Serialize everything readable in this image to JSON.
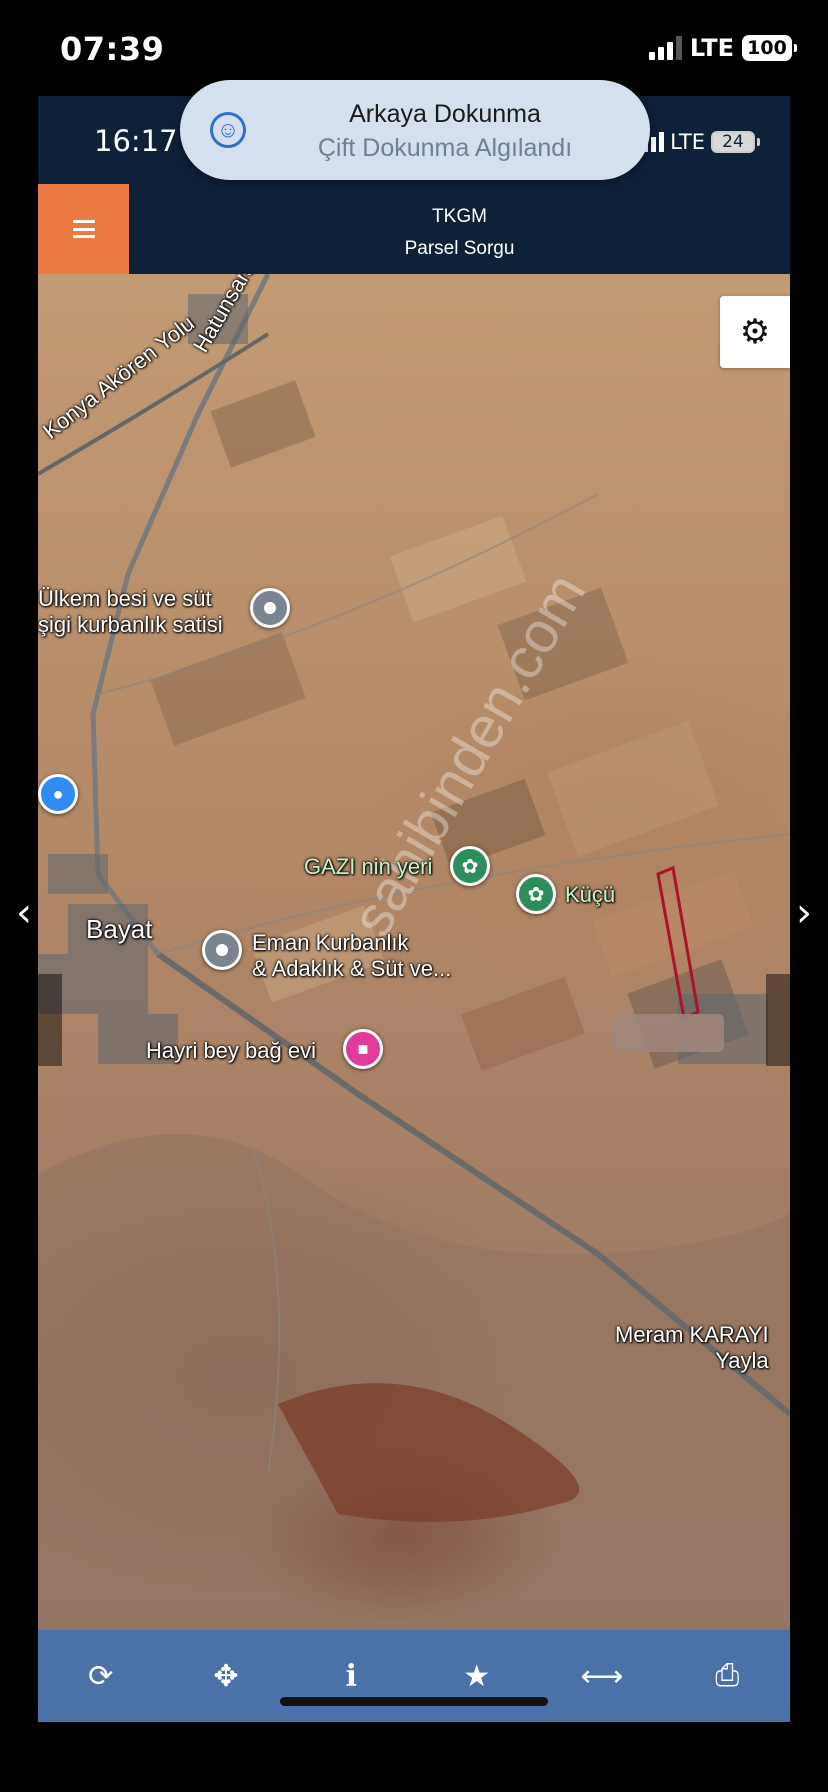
{
  "outer_status": {
    "time": "07:39",
    "network": "LTE",
    "battery": "100"
  },
  "inner_status": {
    "time": "16:17",
    "network": "LTE",
    "battery": "24"
  },
  "notification": {
    "title": "Arkaya Dokunma",
    "subtitle": "Çift Dokunma Algılandı",
    "icon": "accessibility-icon"
  },
  "header": {
    "title": "TKGM",
    "subtitle": "Parsel Sorgu",
    "menu_icon": "hamburger-icon",
    "accent_color": "#ec7a43",
    "background_color": "#0f2039"
  },
  "map": {
    "settings_icon": "gear-icon",
    "roads": [
      {
        "label": "Konya Akören Yolu"
      },
      {
        "label": "Hatunsaray"
      }
    ],
    "places": [
      {
        "label": "Ülkem besi ve süt\nşigi kurbanlık satisi",
        "icon": "location-pin-icon"
      },
      {
        "label": "GAZI nin yeri",
        "icon": "park-icon"
      },
      {
        "label": "Küçü",
        "icon": "park-icon"
      },
      {
        "label": "Bayat",
        "icon": ""
      },
      {
        "label": "Eman Kurbanlık\n& Adaklık & Süt ve...",
        "icon": "location-pin-icon"
      },
      {
        "label": "Hayri bey bağ evi",
        "icon": "lodging-icon"
      },
      {
        "label": "Meram KARAYI\nYayla",
        "icon": ""
      }
    ],
    "shopping_icon": "shopping-bag-icon",
    "watermark": "sahibinden.com",
    "parcel_outline_color": "#b0102a"
  },
  "toolbar": {
    "background_color": "#4a72a8",
    "tools": [
      {
        "name": "refresh",
        "icon": "refresh-icon",
        "glyph": "⟳"
      },
      {
        "name": "locate",
        "icon": "crosshair-icon",
        "glyph": "✥"
      },
      {
        "name": "info",
        "icon": "info-icon",
        "glyph": "i"
      },
      {
        "name": "favorite",
        "icon": "star-icon",
        "glyph": "★"
      },
      {
        "name": "measure",
        "icon": "arrows-horizontal-icon",
        "glyph": "⟷"
      },
      {
        "name": "print",
        "icon": "print-icon",
        "glyph": "⎙"
      }
    ]
  },
  "navigation": {
    "prev_glyph": "‹",
    "next_glyph": "›"
  }
}
